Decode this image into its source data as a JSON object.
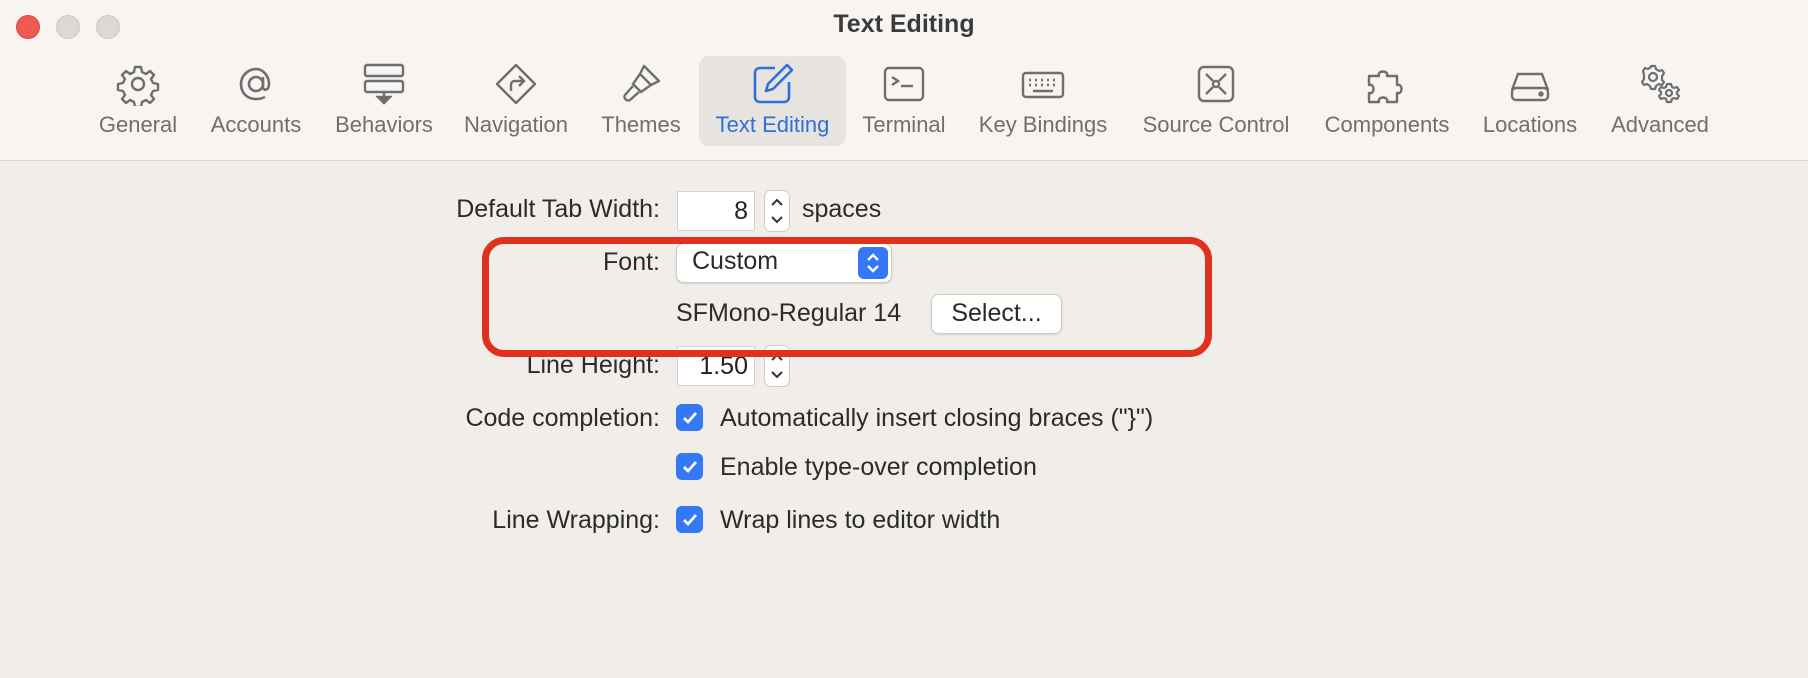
{
  "window": {
    "title": "Text Editing"
  },
  "toolbar": {
    "tabs": [
      {
        "label": "General",
        "icon": "gear-icon"
      },
      {
        "label": "Accounts",
        "icon": "at-sign-icon"
      },
      {
        "label": "Behaviors",
        "icon": "behaviors-icon"
      },
      {
        "label": "Navigation",
        "icon": "navigation-icon"
      },
      {
        "label": "Themes",
        "icon": "paintbrush-icon"
      },
      {
        "label": "Text Editing",
        "icon": "pencil-square-icon",
        "selected": true
      },
      {
        "label": "Terminal",
        "icon": "terminal-icon"
      },
      {
        "label": "Key Bindings",
        "icon": "keyboard-icon"
      },
      {
        "label": "Source Control",
        "icon": "source-control-icon"
      },
      {
        "label": "Components",
        "icon": "puzzle-icon"
      },
      {
        "label": "Locations",
        "icon": "drive-icon"
      },
      {
        "label": "Advanced",
        "icon": "gears-icon"
      }
    ]
  },
  "settings": {
    "tab_width": {
      "label": "Default Tab Width:",
      "value": "8",
      "unit": "spaces"
    },
    "font": {
      "label": "Font:",
      "selected": "Custom",
      "current_font": "SFMono-Regular 14",
      "select_button": "Select..."
    },
    "line_height": {
      "label": "Line Height:",
      "value": "1.50"
    },
    "code_completion": {
      "label": "Code completion:",
      "options": [
        {
          "label": "Automatically insert closing braces (\"}\")",
          "checked": true
        },
        {
          "label": "Enable type-over completion",
          "checked": true
        }
      ]
    },
    "line_wrapping": {
      "label": "Line Wrapping:",
      "option": {
        "label": "Wrap lines to editor width",
        "checked": true
      }
    }
  },
  "colors": {
    "accent": "#3478f6",
    "highlight": "#e0311e",
    "background": "#f1ede9"
  }
}
